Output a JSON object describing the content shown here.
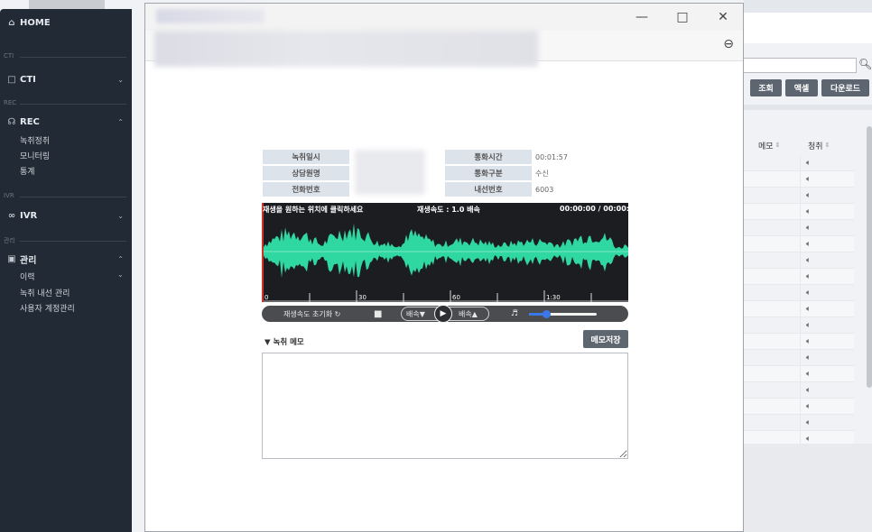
{
  "sidebar": {
    "home": "HOME",
    "sections": {
      "cti": "CTI",
      "rec": "REC",
      "ivr": "IVR",
      "admin": "관리"
    },
    "cti": "CTI",
    "rec": "REC",
    "rec_items": [
      "녹취정취",
      "모니터링",
      "통계"
    ],
    "ivr": "IVR",
    "admin": "관리",
    "admin_items": [
      "이력",
      "녹취 내선 관리",
      "사용자 계정관리"
    ]
  },
  "background": {
    "buttons": [
      "조회",
      "액셀",
      "다운로드"
    ],
    "col_memo": "메모",
    "col_listen": "청취",
    "sort_icon": "⇕",
    "row_icon": "speaker-icon"
  },
  "popup": {
    "info": {
      "rec_date_label": "녹취일시",
      "agent_label": "상담원명",
      "phone_label": "전화번호",
      "duration_label": "통화시간",
      "duration_value": "00:01:57",
      "type_label": "통화구분",
      "type_value": "수신",
      "ext_label": "내선번호",
      "ext_value": "6003"
    },
    "player": {
      "hint": "재생을 원하는 위치에 클릭하세요",
      "speed_text": "재생속도 : 1.0 배속",
      "time_text": "00:00:00 / 00:00:00",
      "ticks": [
        "0",
        "30",
        "60",
        "1:30"
      ],
      "reset_speed": "재생속도 초기화 ↻",
      "slower": "배속▼",
      "faster": "배속▲",
      "volume": 0.25
    },
    "memo": {
      "label": "▼ 녹취 메모",
      "save": "메모저장"
    }
  },
  "colors": {
    "sidebar": "#222a35",
    "wave": "#2fd8a0",
    "wave_bg": "#1c1d21",
    "accent": "#3a77e8"
  }
}
